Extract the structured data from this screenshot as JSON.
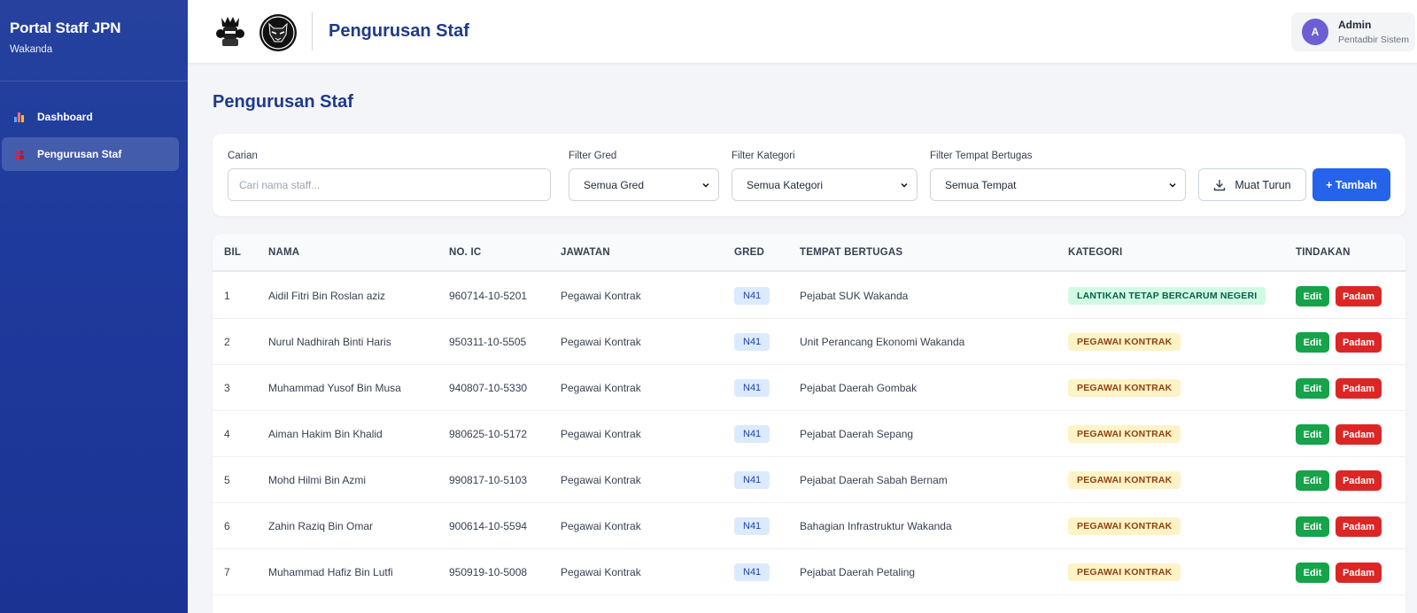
{
  "sidebar": {
    "title": "Portal Staff JPN",
    "subtitle": "Wakanda",
    "items": [
      {
        "label": "Dashboard",
        "icon": "bar-chart-icon",
        "active": false
      },
      {
        "label": "Pengurusan Staf",
        "icon": "people-icon",
        "active": true
      }
    ]
  },
  "header": {
    "title": "Pengurusan Staf",
    "user": {
      "initial": "A",
      "name": "Admin",
      "role": "Pentadbir Sistem"
    }
  },
  "page": {
    "title": "Pengurusan Staf"
  },
  "filters": {
    "search_label": "Carian",
    "search_placeholder": "Cari nama staff...",
    "gred_label": "Filter Gred",
    "gred_value": "Semua Gred",
    "kategori_label": "Filter Kategori",
    "kategori_value": "Semua Kategori",
    "tempat_label": "Filter Tempat Bertugas",
    "tempat_value": "Semua Tempat",
    "download_label": "Muat Turun",
    "add_label": "+ Tambah"
  },
  "table": {
    "headers": {
      "bil": "BIL",
      "nama": "NAMA",
      "ic": "NO. IC",
      "jawatan": "JAWATAN",
      "gred": "GRED",
      "tempat": "TEMPAT BERTUGAS",
      "kategori": "KATEGORI",
      "tindakan": "TINDAKAN"
    },
    "edit_label": "Edit",
    "delete_label": "Padam",
    "rows": [
      {
        "bil": "1",
        "nama": "Aidil Fitri Bin Roslan aziz",
        "ic": "960714-10-5201",
        "jawatan": "Pegawai Kontrak",
        "gred": "N41",
        "tempat": "Pejabat SUK Wakanda",
        "kategori": "LANTIKAN TETAP BERCARUM NEGERI"
      },
      {
        "bil": "2",
        "nama": "Nurul Nadhirah Binti Haris",
        "ic": "950311-10-5505",
        "jawatan": "Pegawai Kontrak",
        "gred": "N41",
        "tempat": "Unit Perancang Ekonomi Wakanda",
        "kategori": "PEGAWAI KONTRAK"
      },
      {
        "bil": "3",
        "nama": "Muhammad Yusof Bin Musa",
        "ic": "940807-10-5330",
        "jawatan": "Pegawai Kontrak",
        "gred": "N41",
        "tempat": "Pejabat Daerah Gombak",
        "kategori": "PEGAWAI KONTRAK"
      },
      {
        "bil": "4",
        "nama": "Aiman Hakim Bin Khalid",
        "ic": "980625-10-5172",
        "jawatan": "Pegawai Kontrak",
        "gred": "N41",
        "tempat": "Pejabat Daerah Sepang",
        "kategori": "PEGAWAI KONTRAK"
      },
      {
        "bil": "5",
        "nama": "Mohd Hilmi Bin Azmi",
        "ic": "990817-10-5103",
        "jawatan": "Pegawai Kontrak",
        "gred": "N41",
        "tempat": "Pejabat Daerah Sabah Bernam",
        "kategori": "PEGAWAI KONTRAK"
      },
      {
        "bil": "6",
        "nama": "Zahin Raziq Bin Omar",
        "ic": "900614-10-5594",
        "jawatan": "Pegawai Kontrak",
        "gred": "N41",
        "tempat": "Bahagian Infrastruktur Wakanda",
        "kategori": "PEGAWAI KONTRAK"
      },
      {
        "bil": "7",
        "nama": "Muhammad Hafiz Bin Lutfi",
        "ic": "950919-10-5008",
        "jawatan": "Pegawai Kontrak",
        "gred": "N41",
        "tempat": "Pejabat Daerah Petaling",
        "kategori": "PEGAWAI KONTRAK"
      }
    ]
  },
  "colors": {
    "sidebar": "#1e3a9c",
    "primary": "#2563eb",
    "success": "#16a34a",
    "danger": "#dc2626",
    "title": "#1e3a8a"
  }
}
